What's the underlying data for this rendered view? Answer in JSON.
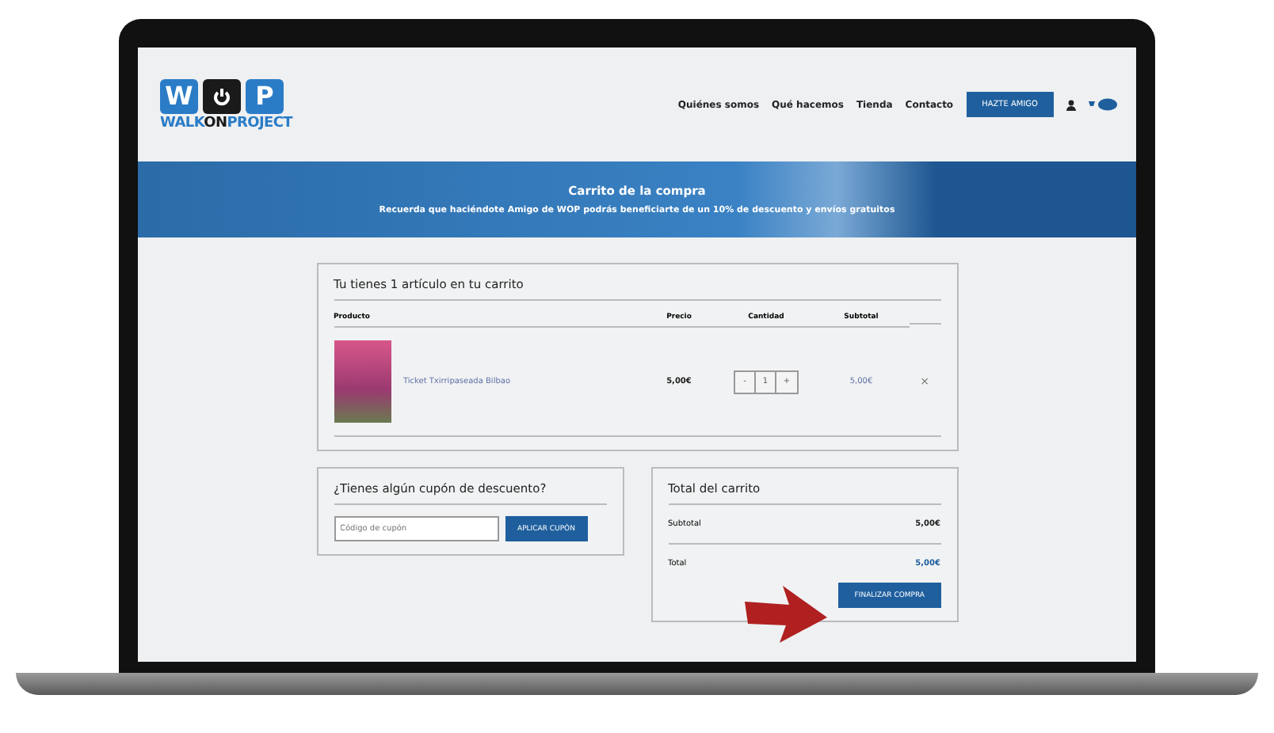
{
  "logo": {
    "letters": [
      "W",
      "P"
    ],
    "wordmark": [
      "WALK",
      "ON",
      "PROJECT"
    ]
  },
  "nav": {
    "links": [
      {
        "label": "Quiénes somos"
      },
      {
        "label": "Qué hacemos"
      },
      {
        "label": "Tienda"
      },
      {
        "label": "Contacto"
      }
    ],
    "cta": "HAZTE AMIGO"
  },
  "banner": {
    "title": "Carrito de la compra",
    "subtitle": "Recuerda que haciéndote Amigo de WOP podrás beneficiarte de un 10% de descuento y envíos gratuitos"
  },
  "cart": {
    "heading": "Tu tienes 1 artículo en tu carrito",
    "columns": [
      "Producto",
      "Precio",
      "Cantidad",
      "Subtotal"
    ],
    "rows": [
      {
        "product": "Ticket Txirripaseada Bilbao",
        "price": "5,00€",
        "minus": "-",
        "quantity": "1",
        "plus": "+",
        "subtotal": "5,00€",
        "remove": "×"
      }
    ]
  },
  "coupon": {
    "heading": "¿Tienes algún cupón de descuento?",
    "placeholder": "Código de cupón",
    "button": "APLICAR CUPÓN"
  },
  "totals": {
    "heading": "Total del carrito",
    "rows": [
      {
        "label": "Subtotal",
        "value": "5,00€",
        "kind": "plain"
      },
      {
        "label": "Total",
        "value": "5,00€",
        "kind": "accent"
      }
    ],
    "button": "FINALIZAR COMPRA"
  }
}
